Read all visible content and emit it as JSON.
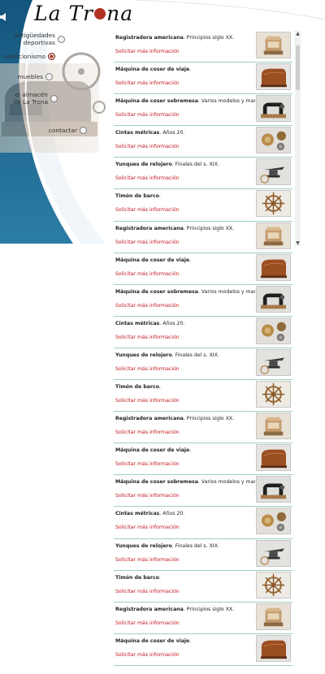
{
  "brand": {
    "logo_left": "La Tr",
    "logo_right": "na"
  },
  "nav": [
    {
      "label_lines": [
        "antigüedades",
        "deportivas"
      ],
      "active": false
    },
    {
      "label_lines": [
        "coleccionismo"
      ],
      "active": true
    },
    {
      "label_lines": [
        "muebles"
      ],
      "active": false
    },
    {
      "label_lines": [
        "el almacén",
        "de La Trona"
      ],
      "active": false
    },
    {
      "label_lines": [
        "contactar"
      ],
      "active": false
    }
  ],
  "products": [
    {
      "name": "Registradora americana",
      "detail": "Principios siglo XX.",
      "link": "Solicitar más información",
      "image": "cash-register"
    },
    {
      "name": "Máquina de coser de viaje",
      "detail": "",
      "link": "Solicitar más información",
      "image": "sewing-case"
    },
    {
      "name": "Máquina de coser sobremesa",
      "detail": "Varios modelos y marcas.",
      "link": "Solicitar más información",
      "image": "sewing-machine"
    },
    {
      "name": "Cintas métricas",
      "detail": "Años 20.",
      "link": "Solicitar más información",
      "image": "tape-measures"
    },
    {
      "name": "Yunques de relojero",
      "detail": "Finales del s. XIX.",
      "link": "Solicitar más información",
      "image": "anvil"
    },
    {
      "name": "Timón de barco",
      "detail": "",
      "link": "Solicitar más información",
      "image": "ship-wheel"
    },
    {
      "name": "Registradora americana",
      "detail": "Principios siglo XX.",
      "link": "Solicitar más información",
      "image": "cash-register"
    },
    {
      "name": "Máquina de coser de viaje",
      "detail": "",
      "link": "Solicitar más información",
      "image": "sewing-case"
    },
    {
      "name": "Máquina de coser sobremesa",
      "detail": "Varios modelos y marcas.",
      "link": "Solicitar más información",
      "image": "sewing-machine"
    },
    {
      "name": "Cintas métricas",
      "detail": "Años 20.",
      "link": "Solicitar más información",
      "image": "tape-measures"
    },
    {
      "name": "Yunques de relojero",
      "detail": "Finales del s. XIX.",
      "link": "Solicitar más información",
      "image": "anvil"
    },
    {
      "name": "Timón de barco",
      "detail": "",
      "link": "Solicitar más información",
      "image": "ship-wheel"
    },
    {
      "name": "Registradora americana",
      "detail": "Principios siglo XX.",
      "link": "Solicitar más información",
      "image": "cash-register"
    },
    {
      "name": "Máquina de coser de viaje",
      "detail": "",
      "link": "Solicitar más información",
      "image": "sewing-case"
    },
    {
      "name": "Máquina de coser sobremesa",
      "detail": "Varios modelos y marcas.",
      "link": "Solicitar más información",
      "image": "sewing-machine"
    },
    {
      "name": "Cintas métricas",
      "detail": "Años 20.",
      "link": "Solicitar más información",
      "image": "tape-measures"
    },
    {
      "name": "Yunques de relojero",
      "detail": "Finales del s. XIX.",
      "link": "Solicitar más información",
      "image": "anvil"
    },
    {
      "name": "Timón de barco",
      "detail": "",
      "link": "Solicitar más información",
      "image": "ship-wheel"
    },
    {
      "name": "Registradora americana",
      "detail": "Principios siglo XX.",
      "link": "Solicitar más información",
      "image": "cash-register"
    },
    {
      "name": "Máquina de coser de viaje",
      "detail": "",
      "link": "Solicitar más información",
      "image": "sewing-case"
    }
  ],
  "colors": {
    "accent": "#c0151d",
    "brand_blue": "#1c5f86",
    "divider": "#9fcfbf",
    "active_dot": "#b33121"
  },
  "icons": {
    "speaker": "speaker-icon",
    "scroll_up": "chevron-up-icon",
    "scroll_down": "chevron-down-icon"
  }
}
